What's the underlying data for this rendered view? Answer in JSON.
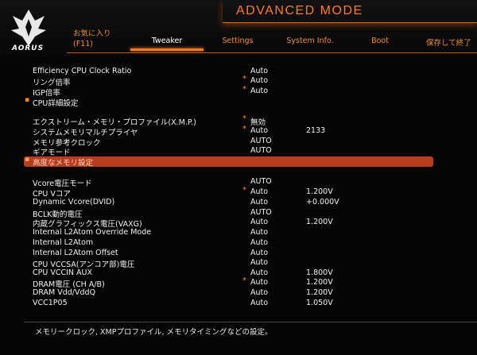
{
  "header": {
    "brand": "AORUS",
    "mode_title": "ADVANCED MODE",
    "tabs": [
      {
        "label_line1": "お気に入り",
        "label_line2": "(F11)"
      },
      {
        "label": "Tweaker"
      },
      {
        "label": "Settings"
      },
      {
        "label": "System Info."
      },
      {
        "label": "Boot"
      },
      {
        "label": "保存して終了"
      }
    ]
  },
  "rows": [
    {
      "label": "Efficiency CPU Clock Ratio",
      "value": "Auto",
      "extra": "",
      "star": ""
    },
    {
      "label": "リング倍率",
      "value": "Auto",
      "extra": "",
      "star": "*"
    },
    {
      "label": "IGP倍率",
      "value": "Auto",
      "extra": "",
      "star": "*"
    },
    {
      "label": "CPU詳細設定",
      "value": "",
      "extra": "",
      "star": "",
      "submenu": "▪"
    },
    {
      "label": "エクストリーム・メモリ・プロファイル(X.M.P.)",
      "value": "無効",
      "extra": "",
      "star": "*"
    },
    {
      "label": "システムメモリマルチプライヤ",
      "value": "Auto",
      "extra": "2133",
      "star": "*"
    },
    {
      "label": "メモリ参考クロック",
      "value": "AUTO",
      "extra": "",
      "star": ""
    },
    {
      "label": "ギアモード",
      "value": "AUTO",
      "extra": "",
      "star": ""
    },
    {
      "label": "高度なメモリ設定",
      "value": "",
      "extra": "",
      "star": "",
      "submenu": "▪"
    },
    {
      "label": "Vcore電圧モード",
      "value": "AUTO",
      "extra": "",
      "star": ""
    },
    {
      "label": "CPU Vコア",
      "value": "Auto",
      "extra": "1.200V",
      "star": "*"
    },
    {
      "label": "Dynamic Vcore(DVID)",
      "value": "Auto",
      "extra": "+0.000V",
      "star": ""
    },
    {
      "label": "BCLK動的電圧",
      "value": "AUTO",
      "extra": "",
      "star": ""
    },
    {
      "label": "内蔵グラフィックス電圧(VAXG)",
      "value": "Auto",
      "extra": "1.200V",
      "star": ""
    },
    {
      "label": "Internal L2Atom Override Mode",
      "value": "Auto",
      "extra": "",
      "star": ""
    },
    {
      "label": "Internal L2Atom",
      "value": "Auto",
      "extra": "",
      "star": ""
    },
    {
      "label": "Internal L2Atom Offset",
      "value": "Auto",
      "extra": "",
      "star": ""
    },
    {
      "label": "CPU VCCSA(アンコア部)電圧",
      "value": "Auto",
      "extra": "",
      "star": ""
    },
    {
      "label": "CPU VCCIN AUX",
      "value": "Auto",
      "extra": "1.800V",
      "star": ""
    },
    {
      "label": "DRAM電圧 (CH A/B)",
      "value": "Auto",
      "extra": "1.200V",
      "star": "*"
    },
    {
      "label": "DRAM Vdd/VddQ",
      "value": "Auto",
      "extra": "1.200V",
      "star": ""
    },
    {
      "label": "VCC1P05",
      "value": "Auto",
      "extra": "1.050V",
      "star": ""
    }
  ],
  "footer": {
    "help_text": "メモリークロック, XMPプロファイル, メモリタイミングなどの設定。"
  }
}
